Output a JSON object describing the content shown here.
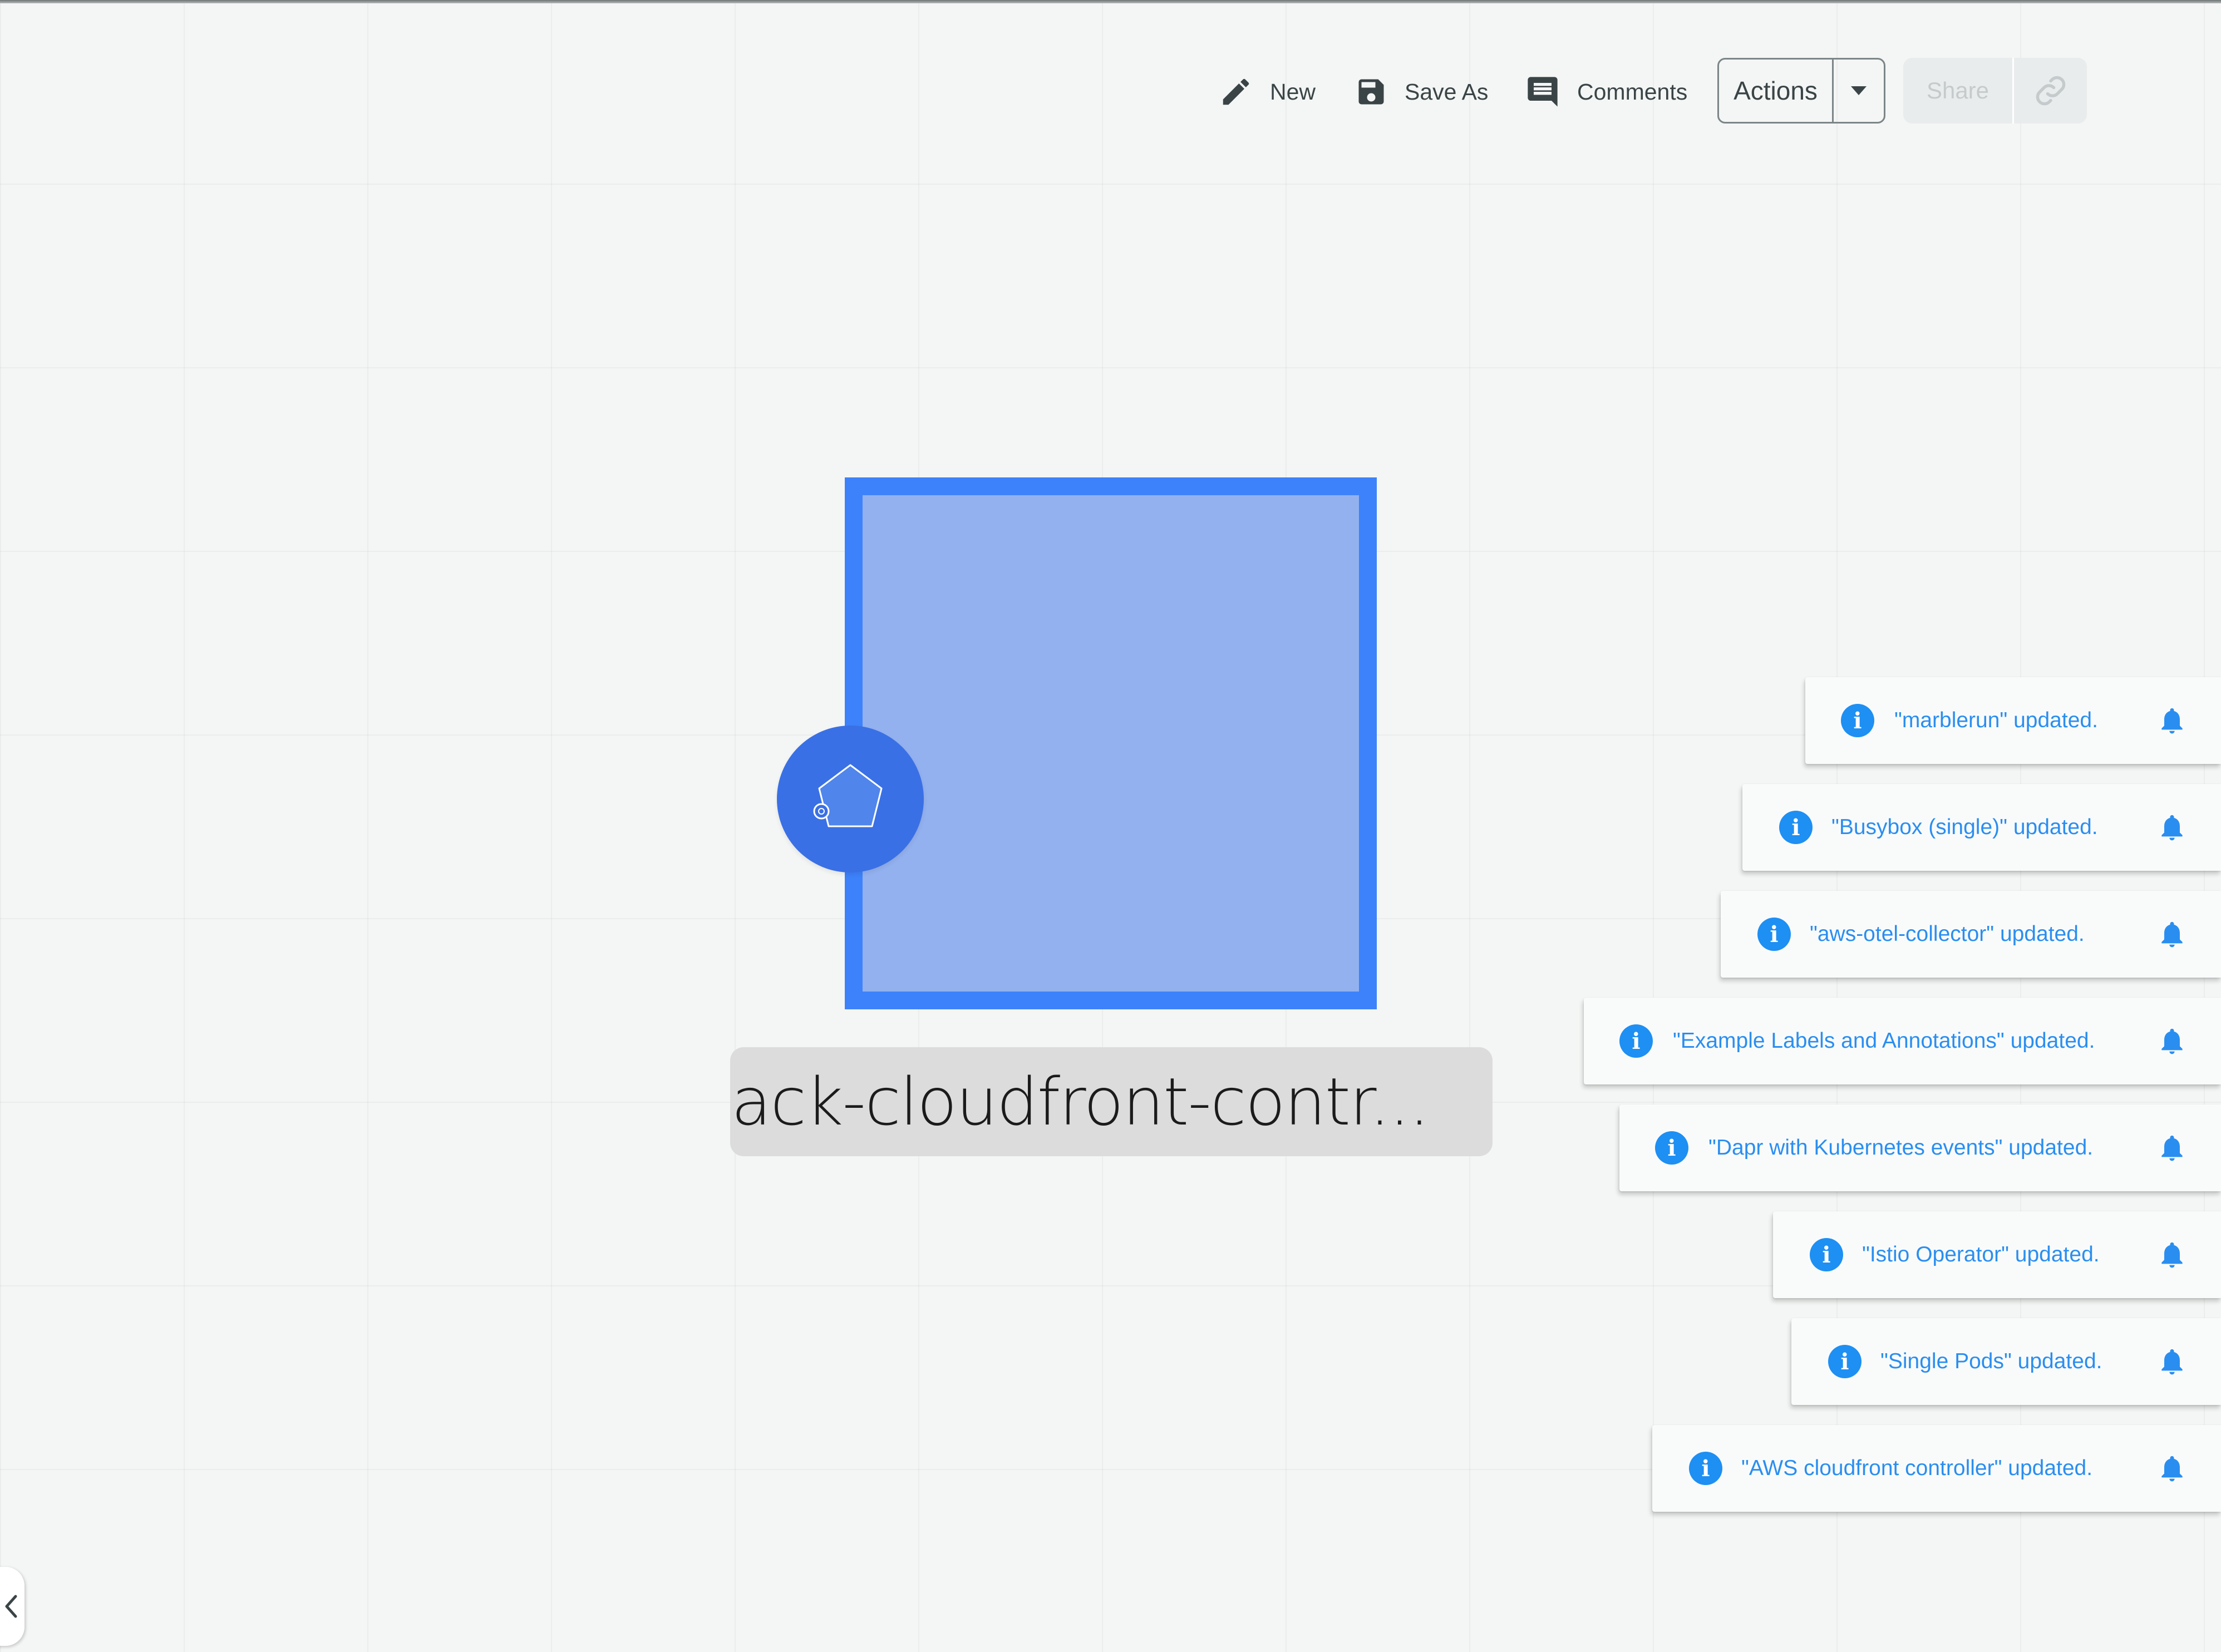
{
  "toolbar": {
    "new_label": "New",
    "save_as_label": "Save As",
    "comments_label": "Comments",
    "actions_label": "Actions",
    "share_label": "Share"
  },
  "canvas": {
    "node_label": "ack-cloudfront-contr..."
  },
  "notifications": [
    {
      "message": "\"marblerun\" updated."
    },
    {
      "message": "\"Busybox (single)\" updated."
    },
    {
      "message": "\"aws-otel-collector\" updated."
    },
    {
      "message": "\"Example Labels and Annotations\" updated."
    },
    {
      "message": "\"Dapr with Kubernetes events\" updated."
    },
    {
      "message": "\"Istio Operator\" updated."
    },
    {
      "message": "\"Single Pods\" updated."
    },
    {
      "message": "\"AWS cloudfront controller\" updated."
    }
  ],
  "icons": {
    "toast_info": "info-icon",
    "toast_bell": "bell-icon",
    "info_glyph": "i"
  },
  "colors": {
    "accent": "#3d82fb",
    "node_fill": "#93b1ef",
    "badge": "#3a70e5",
    "toast_text": "#2a8ef0",
    "canvas_bg": "#f4f6f5"
  }
}
